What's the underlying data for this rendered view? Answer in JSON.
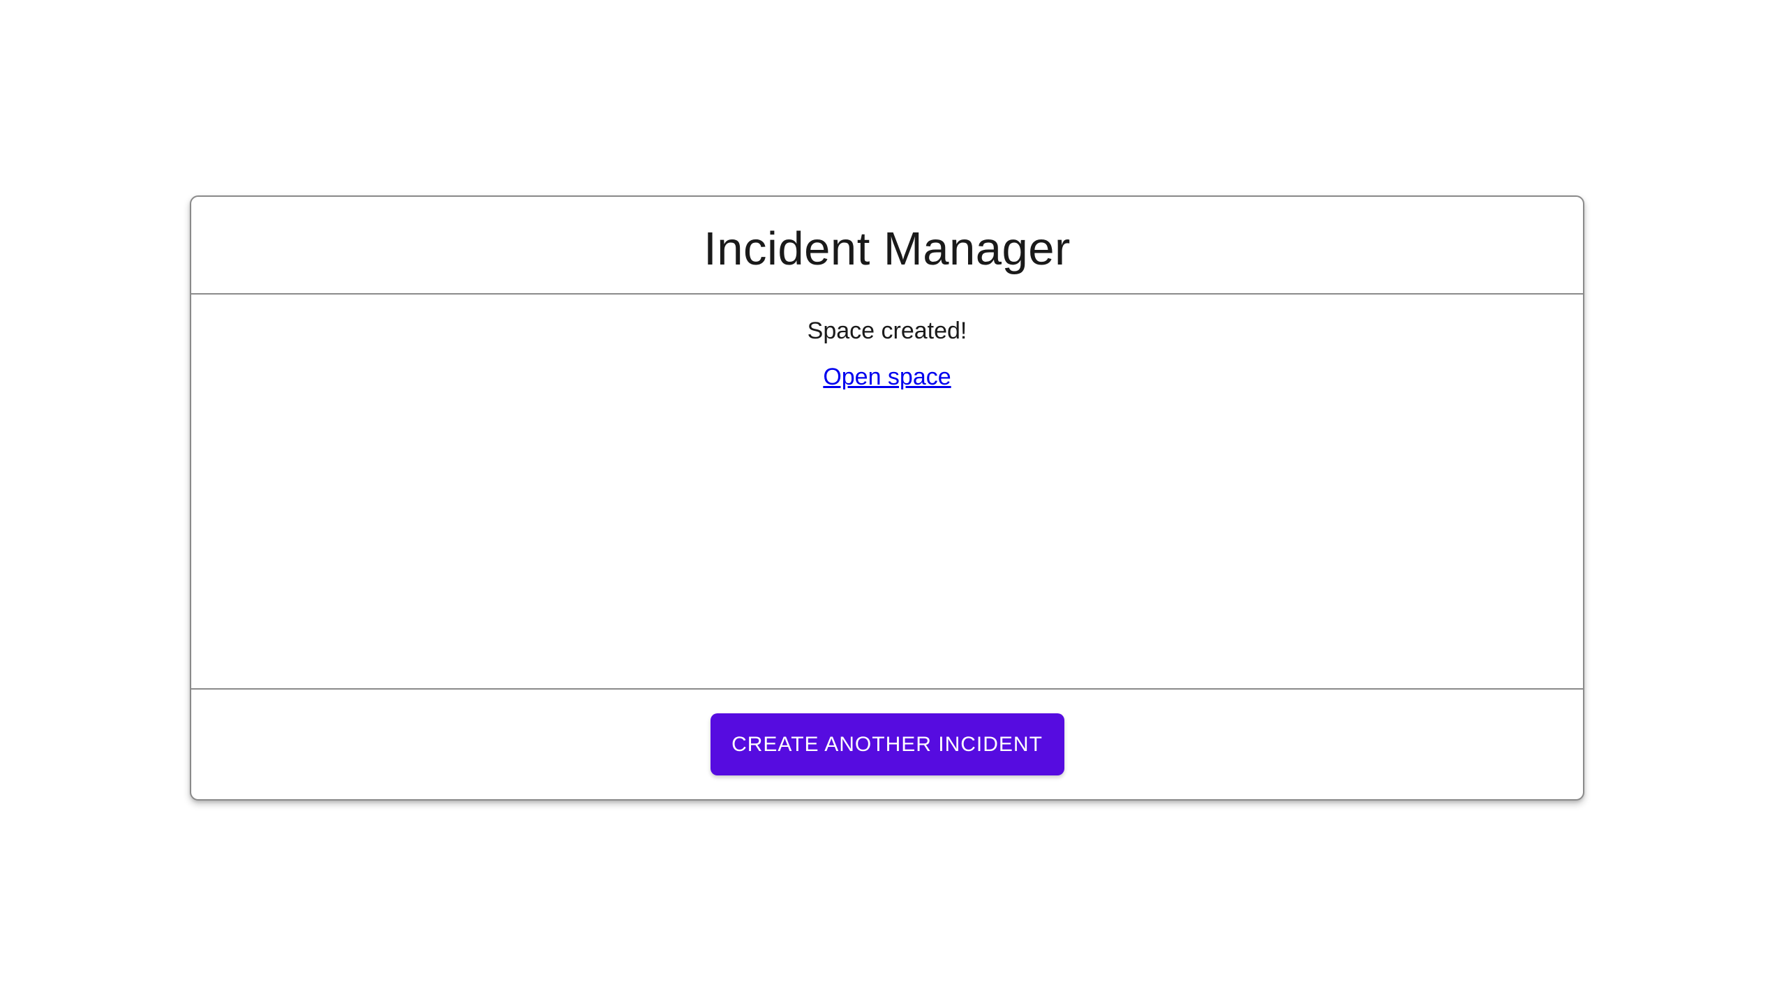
{
  "app": {
    "title": "Incident Manager"
  },
  "content": {
    "status_message": "Space created!",
    "link_label": "Open space"
  },
  "footer": {
    "create_button_label": "CREATE ANOTHER INCIDENT"
  },
  "colors": {
    "background": "#FFFFFF",
    "card_border": "#8A8A8A",
    "divider": "#8A8A8A",
    "title_text": "#1A1A1A",
    "body_text": "#1A1A1A",
    "link": "#0000EE",
    "button_bg": "#560CE0",
    "button_text": "#FFFFFF"
  }
}
